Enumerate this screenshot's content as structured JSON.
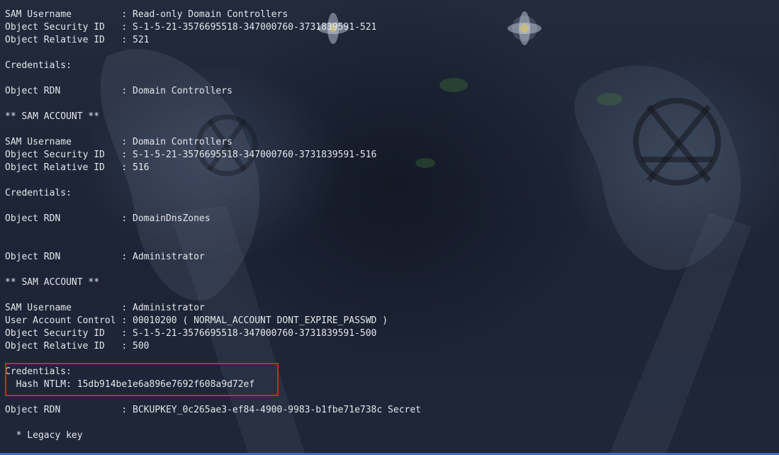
{
  "terminal": {
    "lines": [
      "SAM Username         : Read-only Domain Controllers",
      "Object Security ID   : S-1-5-21-3576695518-347000760-3731839591-521",
      "Object Relative ID   : 521",
      "",
      "Credentials:",
      "",
      "Object RDN           : Domain Controllers",
      "",
      "** SAM ACCOUNT **",
      "",
      "SAM Username         : Domain Controllers",
      "Object Security ID   : S-1-5-21-3576695518-347000760-3731839591-516",
      "Object Relative ID   : 516",
      "",
      "Credentials:",
      "",
      "Object RDN           : DomainDnsZones",
      "",
      "",
      "Object RDN           : Administrator",
      "",
      "** SAM ACCOUNT **",
      "",
      "SAM Username         : Administrator",
      "User Account Control : 00010200 ( NORMAL_ACCOUNT DONT_EXPIRE_PASSWD )",
      "Object Security ID   : S-1-5-21-3576695518-347000760-3731839591-500",
      "Object Relative ID   : 500",
      "",
      "Credentials:",
      "  Hash NTLM: 15db914be1e6a896e7692f608a9d72ef",
      "",
      "Object RDN           : BCKUPKEY_0c265ae3-ef84-4900-9983-b1fbe71e738c Secret",
      "",
      "  * Legacy key"
    ]
  },
  "colors": {
    "text": "#e3e6ec",
    "highlight": "#e01e1e",
    "background": "#1c2233"
  }
}
